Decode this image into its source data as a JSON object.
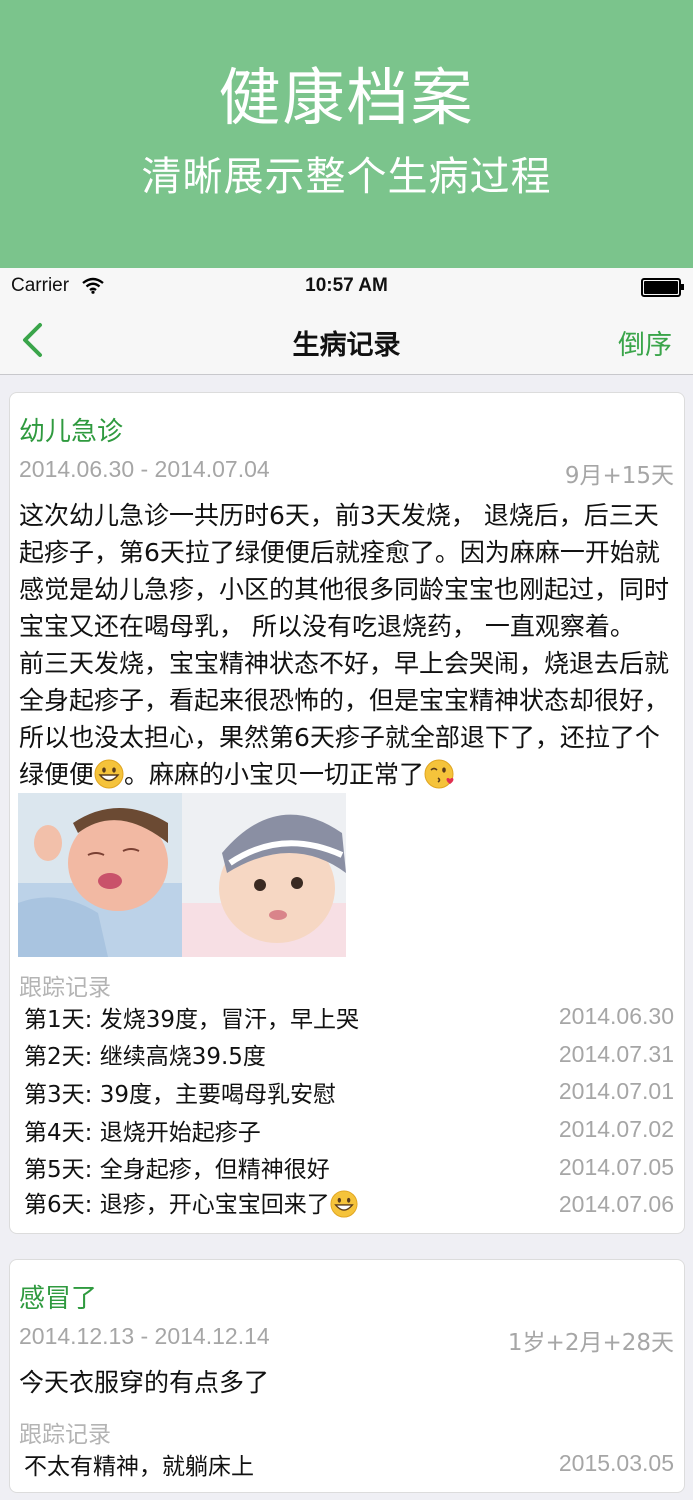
{
  "banner": {
    "title": "健康档案",
    "subtitle": "清晰展示整个生病过程"
  },
  "status_bar": {
    "carrier": "Carrier",
    "time": "10:57 AM"
  },
  "nav": {
    "title": "生病记录",
    "sort_label": "倒序"
  },
  "records": [
    {
      "title": "幼儿急诊",
      "date_range": "2014.06.30 - 2014.07.04",
      "age": "9月+15天",
      "desc_p1": "这次幼儿急诊一共历时6天，前3天发烧， 退烧后，后三天起疹子，第6天拉了绿便便后就痊愈了。因为麻麻一开始就感觉是幼儿急疹，小区的其他很多同龄宝宝也刚起过，同时宝宝又还在喝母乳， 所以没有吃退烧药， 一直观察着。",
      "desc_p2_a": "前三天发烧，宝宝精神状态不好，早上会哭闹，烧退去后就全身起疹子，看起来很恐怖的，但是宝宝精神状态却很好， 所以也没太担心，果然第6天疹子就全部退下了，还拉了个绿便便",
      "desc_p2_b": "。麻麻的小宝贝一切正常了",
      "emoji_1": "grinning-face-emoji",
      "emoji_2": "face-blowing-kiss-emoji",
      "photos": [
        "crying-baby-photo",
        "baby-in-hat-photo"
      ],
      "track_label": "跟踪记录",
      "tracks": [
        {
          "text": "第1天: 发烧39度，冒汗，早上哭",
          "date": "2014.06.30"
        },
        {
          "text": "第2天: 继续高烧39.5度",
          "date": "2014.07.31"
        },
        {
          "text": "第3天: 39度，主要喝母乳安慰",
          "date": "2014.07.01"
        },
        {
          "text": "第4天: 退烧开始起疹子",
          "date": "2014.07.02"
        },
        {
          "text": "第5天: 全身起疹，但精神很好",
          "date": "2014.07.05"
        },
        {
          "text": "第6天: 退疹，开心宝宝回来了",
          "date": "2014.07.06"
        }
      ]
    },
    {
      "title": "感冒了",
      "date_range": "2014.12.13 - 2014.12.14",
      "age": "1岁+2月+28天",
      "desc": "今天衣服穿的有点多了",
      "track_label": "跟踪记录",
      "tracks": [
        {
          "text": "不太有精神，就躺床上",
          "date": "2015.03.05"
        }
      ]
    }
  ],
  "colors": {
    "banner": "#7bc48c",
    "accent": "#3aa54a",
    "title_green": "#2f9a3f",
    "muted": "#a6a6a6"
  }
}
